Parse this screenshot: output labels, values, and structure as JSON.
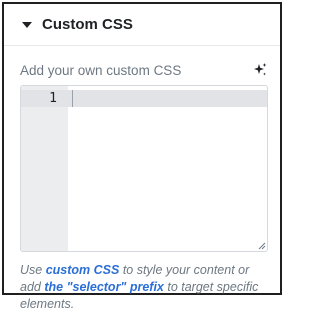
{
  "panel": {
    "section_title": "Custom CSS",
    "field_label": "Add your own custom CSS",
    "ai_icon": "sparkle-icon",
    "caret_icon": "caret-down-icon"
  },
  "editor": {
    "line_numbers": [
      "1"
    ],
    "content": ""
  },
  "help": {
    "prefix": "Use ",
    "link_custom_css": "custom CSS",
    "middle": " to style your content or add ",
    "link_selector": "the \"selector\" prefix",
    "suffix": " to target specific elements."
  },
  "colors": {
    "border": "#1f1f1f",
    "label": "#6d7882",
    "link": "#2b6fd6",
    "gutter": "#ebedef"
  }
}
